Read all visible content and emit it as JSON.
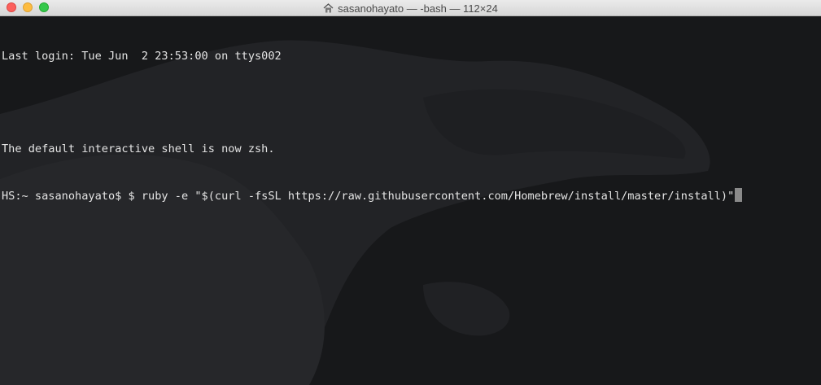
{
  "window": {
    "title": "sasanohayato — -bash — 112×24"
  },
  "terminal": {
    "lines": [
      "Last login: Tue Jun  2 23:53:00 on ttys002",
      "",
      "The default interactive shell is now zsh.",
      "HS:~ sasanohayato$ $ ruby -e \"$(curl -fsSL https://raw.githubusercontent.com/Homebrew/install/master/install)\""
    ]
  },
  "colors": {
    "background": "#17181a",
    "foreground": "#e4e4e4",
    "cursor": "#8a8a8a"
  }
}
